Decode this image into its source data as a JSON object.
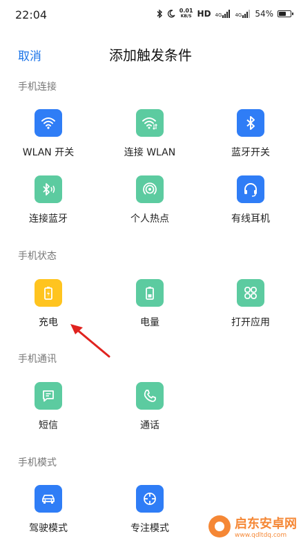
{
  "status_bar": {
    "time": "22:04",
    "speed_value": "0.01",
    "speed_unit": "KB/S",
    "hd": "HD",
    "net1": "4G",
    "net2": "4G",
    "battery": "54%"
  },
  "header": {
    "cancel_label": "取消",
    "title": "添加触发条件"
  },
  "sections": [
    {
      "title": "手机连接",
      "items": [
        {
          "label": "WLAN 开关",
          "icon": "wifi-icon"
        },
        {
          "label": "连接 WLAN",
          "icon": "wifi-connect-icon"
        },
        {
          "label": "蓝牙开关",
          "icon": "bluetooth-icon"
        },
        {
          "label": "连接蓝牙",
          "icon": "bluetooth-connect-icon"
        },
        {
          "label": "个人热点",
          "icon": "hotspot-icon"
        },
        {
          "label": "有线耳机",
          "icon": "headphones-icon"
        }
      ]
    },
    {
      "title": "手机状态",
      "items": [
        {
          "label": "充电",
          "icon": "charging-icon"
        },
        {
          "label": "电量",
          "icon": "battery-level-icon"
        },
        {
          "label": "打开应用",
          "icon": "apps-icon"
        }
      ]
    },
    {
      "title": "手机通讯",
      "items": [
        {
          "label": "短信",
          "icon": "message-icon"
        },
        {
          "label": "通话",
          "icon": "phone-icon"
        }
      ]
    },
    {
      "title": "手机模式",
      "items": [
        {
          "label": "驾驶模式",
          "icon": "car-icon"
        },
        {
          "label": "专注模式",
          "icon": "focus-icon"
        }
      ]
    }
  ],
  "colors": {
    "blue": "#2f7df6",
    "green": "#5ccba0",
    "yellow": "#ffc41f",
    "accent": "#1a73e8"
  },
  "watermark": {
    "name": "启东安卓网",
    "url": "www.qdltdq.com"
  }
}
